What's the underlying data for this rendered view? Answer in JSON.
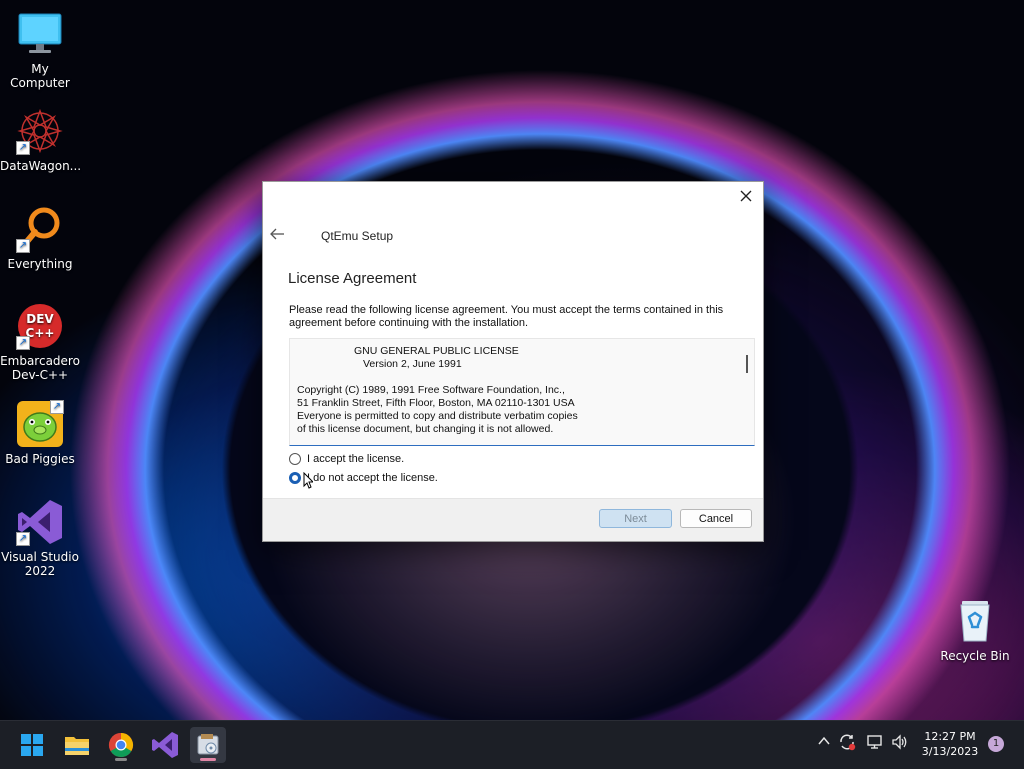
{
  "desktop": {
    "icons": [
      {
        "label": "My Computer",
        "icon": "monitor-icon"
      },
      {
        "label": "DataWagon...",
        "icon": "datawagon-icon"
      },
      {
        "label": "Everything",
        "icon": "everything-search-icon"
      },
      {
        "label": "Embarcadero Dev-C++",
        "icon": "devcpp-icon",
        "glyph_text": "DEV C++"
      },
      {
        "label": "Bad Piggies",
        "icon": "bad-piggies-icon"
      },
      {
        "label": "Visual Studio 2022",
        "icon": "visual-studio-icon"
      },
      {
        "label": "Recycle Bin",
        "icon": "recycle-bin-icon"
      }
    ]
  },
  "dialog": {
    "title": "QtEmu Setup",
    "heading": "License Agreement",
    "intro": "Please read the following license agreement. You must accept the terms contained in this agreement before continuing with the installation.",
    "license_lines": [
      "GNU GENERAL PUBLIC LICENSE",
      "Version 2, June 1991",
      "Copyright (C) 1989, 1991 Free Software Foundation, Inc.,",
      "51 Franklin Street, Fifth Floor, Boston, MA 02110-1301 USA",
      "Everyone is permitted to copy and distribute verbatim copies",
      "of this license document, but changing it is not allowed."
    ],
    "options": [
      {
        "label": "I accept the license.",
        "checked": false
      },
      {
        "label": "I do not accept the license.",
        "checked": true
      }
    ],
    "buttons": {
      "next": "Next",
      "cancel": "Cancel"
    },
    "next_enabled": false
  },
  "taskbar": {
    "apps": [
      "start-icon",
      "file-explorer-icon",
      "chrome-icon",
      "visual-studio-icon",
      "qtemu-setup-icon"
    ],
    "active_app": "qtemu-setup-icon",
    "tray": [
      "chevron-up-icon",
      "sync-icon",
      "network-icon",
      "volume-icon"
    ],
    "time": "12:27 PM",
    "date": "3/13/2023",
    "notification_count": "1"
  }
}
